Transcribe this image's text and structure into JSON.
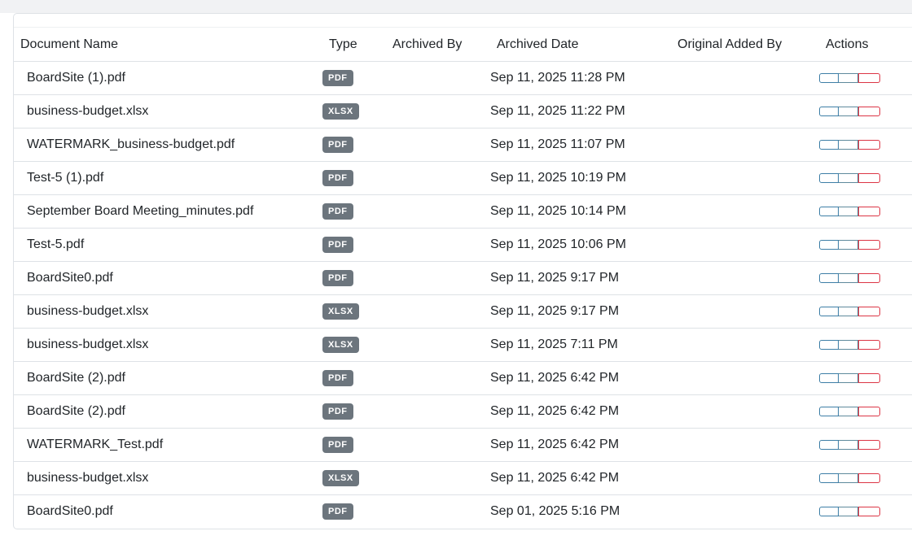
{
  "table": {
    "headers": {
      "name": "Document Name",
      "type": "Type",
      "archived_by": "Archived By",
      "archived_date": "Archived Date",
      "original_added_by": "Original Added By",
      "actions": "Actions"
    },
    "rows": [
      {
        "name": "BoardSite (1).pdf",
        "type": "PDF",
        "archived_by": "",
        "archived_date": "Sep 11, 2025 11:28 PM",
        "original_added_by": ""
      },
      {
        "name": "business-budget.xlsx",
        "type": "XLSX",
        "archived_by": "",
        "archived_date": "Sep 11, 2025 11:22 PM",
        "original_added_by": ""
      },
      {
        "name": "WATERMARK_business-budget.pdf",
        "type": "PDF",
        "archived_by": "",
        "archived_date": "Sep 11, 2025 11:07 PM",
        "original_added_by": ""
      },
      {
        "name": "Test-5 (1).pdf",
        "type": "PDF",
        "archived_by": "",
        "archived_date": "Sep 11, 2025 10:19 PM",
        "original_added_by": ""
      },
      {
        "name": "September Board Meeting_minutes.pdf",
        "type": "PDF",
        "archived_by": "",
        "archived_date": "Sep 11, 2025 10:14 PM",
        "original_added_by": ""
      },
      {
        "name": "Test-5.pdf",
        "type": "PDF",
        "archived_by": "",
        "archived_date": "Sep 11, 2025 10:06 PM",
        "original_added_by": ""
      },
      {
        "name": "BoardSite0.pdf",
        "type": "PDF",
        "archived_by": "",
        "archived_date": "Sep 11, 2025 9:17 PM",
        "original_added_by": ""
      },
      {
        "name": "business-budget.xlsx",
        "type": "XLSX",
        "archived_by": "",
        "archived_date": "Sep 11, 2025 9:17 PM",
        "original_added_by": ""
      },
      {
        "name": "business-budget.xlsx",
        "type": "XLSX",
        "archived_by": "",
        "archived_date": "Sep 11, 2025 7:11 PM",
        "original_added_by": ""
      },
      {
        "name": "BoardSite (2).pdf",
        "type": "PDF",
        "archived_by": "",
        "archived_date": "Sep 11, 2025 6:42 PM",
        "original_added_by": ""
      },
      {
        "name": "BoardSite (2).pdf",
        "type": "PDF",
        "archived_by": "",
        "archived_date": "Sep 11, 2025 6:42 PM",
        "original_added_by": ""
      },
      {
        "name": "WATERMARK_Test.pdf",
        "type": "PDF",
        "archived_by": "",
        "archived_date": "Sep 11, 2025 6:42 PM",
        "original_added_by": ""
      },
      {
        "name": "business-budget.xlsx",
        "type": "XLSX",
        "archived_by": "",
        "archived_date": "Sep 11, 2025 6:42 PM",
        "original_added_by": ""
      },
      {
        "name": "BoardSite0.pdf",
        "type": "PDF",
        "archived_by": "",
        "archived_date": "Sep 01, 2025 5:16 PM",
        "original_added_by": ""
      }
    ]
  },
  "colors": {
    "badge_bg": "#6c757d",
    "primary_outline": "#3d7ea6",
    "danger_outline": "#dc3545",
    "border": "#dee2e6",
    "page_bg": "#f1f2f4"
  },
  "icons": {
    "view_button": "view-icon",
    "restore_button": "restore-icon",
    "delete_button": "trash-icon"
  }
}
